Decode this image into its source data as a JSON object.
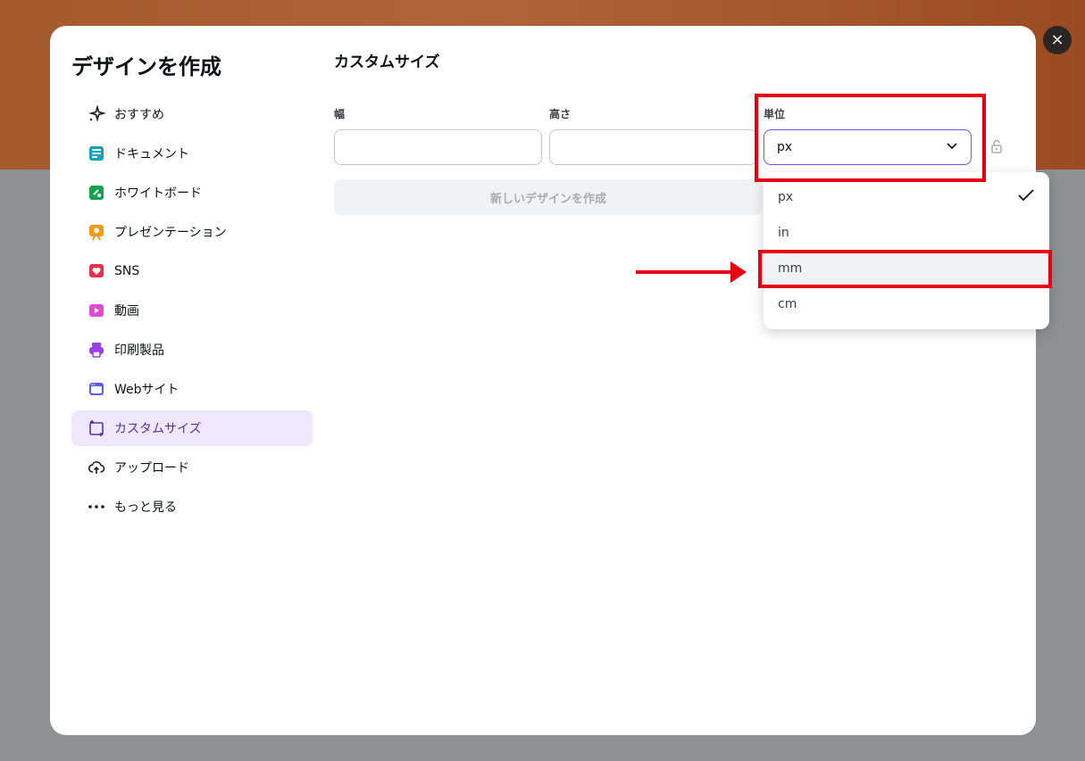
{
  "modal": {
    "title": "デザインを作成",
    "close_label": "×"
  },
  "nav": {
    "items": [
      {
        "label": "おすすめ",
        "icon": "sparkle-icon"
      },
      {
        "label": "ドキュメント",
        "icon": "document-icon"
      },
      {
        "label": "ホワイトボード",
        "icon": "whiteboard-icon"
      },
      {
        "label": "プレゼンテーション",
        "icon": "presentation-icon"
      },
      {
        "label": "SNS",
        "icon": "heart-icon"
      },
      {
        "label": "動画",
        "icon": "video-icon"
      },
      {
        "label": "印刷製品",
        "icon": "printer-icon"
      },
      {
        "label": "Webサイト",
        "icon": "website-icon"
      },
      {
        "label": "カスタムサイズ",
        "icon": "custom-size-icon",
        "active": true
      },
      {
        "label": "アップロード",
        "icon": "cloud-upload-icon"
      },
      {
        "label": "もっと見る",
        "icon": "more-dots-icon"
      }
    ]
  },
  "custom": {
    "title": "カスタムサイズ",
    "width_label": "幅",
    "width_value": "",
    "height_label": "高さ",
    "height_value": "",
    "unit_label": "単位",
    "unit_selected": "px",
    "create_button": "新しいデザインを作成"
  },
  "unit_options": [
    "px",
    "in",
    "mm",
    "cm"
  ],
  "colors": {
    "accent": "#7d4fe0",
    "highlight_red": "#e60012",
    "active_nav_bg": "#efe8fc"
  }
}
